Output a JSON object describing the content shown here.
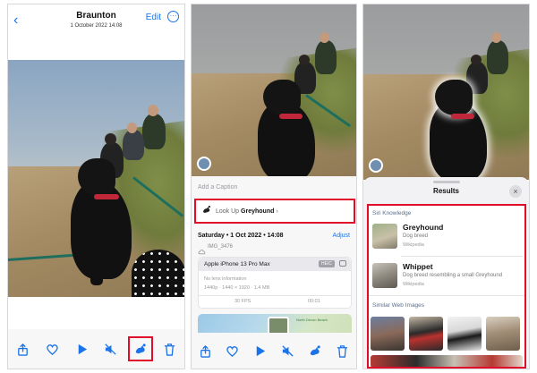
{
  "panel1": {
    "back_icon": "chevron-left-icon",
    "title": "Braunton",
    "subtitle": "1 October 2022  14:08",
    "edit_label": "Edit",
    "more_icon": "ellipsis-circle-icon",
    "more_glyph": "···"
  },
  "panel2": {
    "caption_placeholder": "Add a Caption",
    "lookup": {
      "prefix": "Look Up ",
      "subject": "Greyhound",
      "chevron": "›"
    },
    "date": "Saturday • 1 Oct 2022 • 14:08",
    "adjust_label": "Adjust",
    "filename": "IMG_3476",
    "device": "Apple iPhone 13 Pro Max",
    "format_badge": "HEIC",
    "lens": "No lens information",
    "specs": "1440p  ·  1440 × 1920  ·  1.4 MB",
    "fps": "30 FPS",
    "duration": "00:01",
    "map_label": "North Devon Beach"
  },
  "panel3": {
    "results_title": "Results",
    "close_glyph": "×",
    "siri_section": "Siri Knowledge",
    "items": [
      {
        "title": "Greyhound",
        "desc": "Dog breed",
        "source": "Wikipedia"
      },
      {
        "title": "Whippet",
        "desc": "Dog breed resembling a small Greyhound",
        "source": "Wikipedia"
      }
    ],
    "web_section": "Similar Web Images"
  },
  "toolbar_icons": [
    "share-icon",
    "heart-icon",
    "play-icon",
    "mute-icon",
    "visual-lookup-icon",
    "trash-icon"
  ],
  "colors": {
    "accent": "#1a73e8",
    "highlight": "#e00d2a",
    "collar": "#c0283a",
    "leash": "#1e6e5e"
  }
}
